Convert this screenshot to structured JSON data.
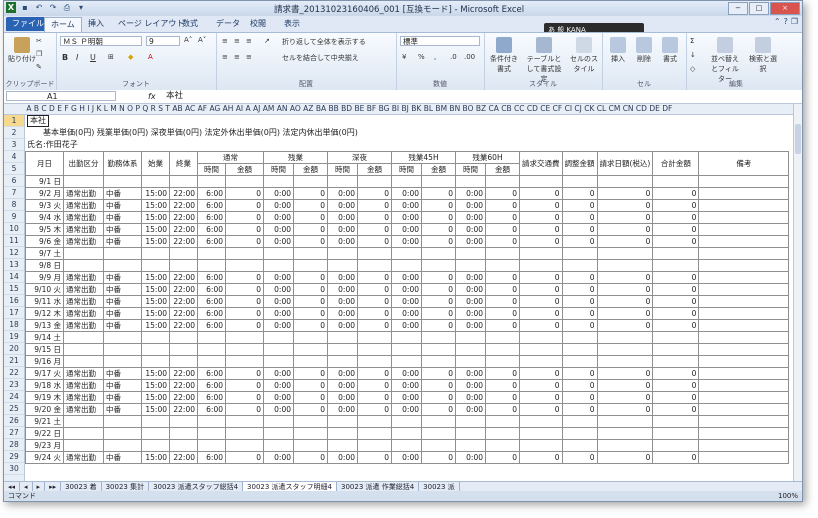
{
  "window": {
    "title": "請求書_20131023160406_001 [互換モード] - Microsoft Excel",
    "qat_icons": [
      "excel-icon",
      "save-icon",
      "undo-icon",
      "redo-icon",
      "print-icon",
      "customize-icon"
    ],
    "controls": [
      "−",
      "□",
      "×"
    ]
  },
  "ime": {
    "label": "あ 般 KANA"
  },
  "tabs": [
    "ファイル",
    "ホーム",
    "挿入",
    "ページ レイアウト",
    "数式",
    "データ",
    "校閲",
    "表示"
  ],
  "ribbon": {
    "clipboard": {
      "label": "クリップボード",
      "paste": "貼り付け"
    },
    "font": {
      "label": "フォント",
      "name": "ＭＳ Ｐ明朝",
      "size": "9",
      "styles": [
        "B",
        "I",
        "U"
      ]
    },
    "alignment": {
      "label": "配置",
      "wrap": "折り返して全体を表示する",
      "merge": "セルを結合して中央揃え"
    },
    "number": {
      "label": "数値",
      "format": "標準"
    },
    "styles": {
      "label": "スタイル",
      "cond": "条件付き書式",
      "table": "テーブルとして書式設定",
      "cell": "セルのスタイル"
    },
    "cells": {
      "label": "セル",
      "insert": "挿入",
      "delete": "削除",
      "format": "書式"
    },
    "editing": {
      "label": "編集",
      "sort": "並べ替えとフィルター",
      "find": "検索と選択"
    }
  },
  "formula_bar": {
    "name_box": "A1",
    "fx": "fx",
    "value": "本社"
  },
  "column_letters": "A B C D E F G H I J K L M N O P Q R S T AB AC AF AG AH AI A AJ AM AN AO AZ BA BB BD BE BF BG BI BJ BK BL BM BN BO BZ CA CB CC CD CE CF CI CJ CK CL CM CN CD DE DF",
  "sheet": {
    "a1": "本社",
    "units": "基本単価(0円)  残業単価(0円)  深夜単価(0円)  法定外休出単価(0円)  法定内休出単価(0円)",
    "name": "氏名:作田花子",
    "headers": {
      "day": "月日",
      "attend": "出勤区分",
      "shift": "勤務体系",
      "start": "始業",
      "end": "終業",
      "normal": "通常",
      "overtime": "残業",
      "night": "深夜",
      "ot45": "残業45H",
      "ot60": "残業60H",
      "expense": "請求交通費",
      "adjust": "調整金額",
      "invoice": "請求日額(税込)",
      "total": "合計金額",
      "note": "備考",
      "time": "時間",
      "amount": "金額"
    },
    "rows": [
      [
        "9/1 日",
        "",
        "",
        "",
        "",
        "",
        "",
        "",
        "",
        "",
        "",
        "",
        "",
        "",
        "",
        "",
        "",
        "",
        "",
        "",
        ""
      ],
      [
        "9/2 月",
        "通常出勤",
        "中番",
        "15:00",
        "22:00",
        "6:00",
        "0",
        "0:00",
        "0",
        "0:00",
        "0",
        "0:00",
        "0",
        "0:00",
        "0",
        "0",
        "0",
        "0",
        "0",
        ""
      ],
      [
        "9/3 火",
        "通常出勤",
        "中番",
        "15:00",
        "22:00",
        "6:00",
        "0",
        "0:00",
        "0",
        "0:00",
        "0",
        "0:00",
        "0",
        "0:00",
        "0",
        "0",
        "0",
        "0",
        "0",
        ""
      ],
      [
        "9/4 水",
        "通常出勤",
        "中番",
        "15:00",
        "22:00",
        "6:00",
        "0",
        "0:00",
        "0",
        "0:00",
        "0",
        "0:00",
        "0",
        "0:00",
        "0",
        "0",
        "0",
        "0",
        "0",
        ""
      ],
      [
        "9/5 木",
        "通常出勤",
        "中番",
        "15:00",
        "22:00",
        "6:00",
        "0",
        "0:00",
        "0",
        "0:00",
        "0",
        "0:00",
        "0",
        "0:00",
        "0",
        "0",
        "0",
        "0",
        "0",
        ""
      ],
      [
        "9/6 金",
        "通常出勤",
        "中番",
        "15:00",
        "22:00",
        "6:00",
        "0",
        "0:00",
        "0",
        "0:00",
        "0",
        "0:00",
        "0",
        "0:00",
        "0",
        "0",
        "0",
        "0",
        "0",
        ""
      ],
      [
        "9/7 土",
        "",
        "",
        "",
        "",
        "",
        "",
        "",
        "",
        "",
        "",
        "",
        "",
        "",
        "",
        "",
        "",
        "",
        "",
        ""
      ],
      [
        "9/8 日",
        "",
        "",
        "",
        "",
        "",
        "",
        "",
        "",
        "",
        "",
        "",
        "",
        "",
        "",
        "",
        "",
        "",
        "",
        ""
      ],
      [
        "9/9 月",
        "通常出勤",
        "中番",
        "15:00",
        "22:00",
        "6:00",
        "0",
        "0:00",
        "0",
        "0:00",
        "0",
        "0:00",
        "0",
        "0:00",
        "0",
        "0",
        "0",
        "0",
        "0",
        ""
      ],
      [
        "9/10 火",
        "通常出勤",
        "中番",
        "15:00",
        "22:00",
        "6:00",
        "0",
        "0:00",
        "0",
        "0:00",
        "0",
        "0:00",
        "0",
        "0:00",
        "0",
        "0",
        "0",
        "0",
        "0",
        ""
      ],
      [
        "9/11 水",
        "通常出勤",
        "中番",
        "15:00",
        "22:00",
        "6:00",
        "0",
        "0:00",
        "0",
        "0:00",
        "0",
        "0:00",
        "0",
        "0:00",
        "0",
        "0",
        "0",
        "0",
        "0",
        ""
      ],
      [
        "9/12 木",
        "通常出勤",
        "中番",
        "15:00",
        "22:00",
        "6:00",
        "0",
        "0:00",
        "0",
        "0:00",
        "0",
        "0:00",
        "0",
        "0:00",
        "0",
        "0",
        "0",
        "0",
        "0",
        ""
      ],
      [
        "9/13 金",
        "通常出勤",
        "中番",
        "15:00",
        "22:00",
        "6:00",
        "0",
        "0:00",
        "0",
        "0:00",
        "0",
        "0:00",
        "0",
        "0:00",
        "0",
        "0",
        "0",
        "0",
        "0",
        ""
      ],
      [
        "9/14 土",
        "",
        "",
        "",
        "",
        "",
        "",
        "",
        "",
        "",
        "",
        "",
        "",
        "",
        "",
        "",
        "",
        "",
        "",
        ""
      ],
      [
        "9/15 日",
        "",
        "",
        "",
        "",
        "",
        "",
        "",
        "",
        "",
        "",
        "",
        "",
        "",
        "",
        "",
        "",
        "",
        "",
        ""
      ],
      [
        "9/16 月",
        "",
        "",
        "",
        "",
        "",
        "",
        "",
        "",
        "",
        "",
        "",
        "",
        "",
        "",
        "",
        "",
        "",
        "",
        ""
      ],
      [
        "9/17 火",
        "通常出勤",
        "中番",
        "15:00",
        "22:00",
        "6:00",
        "0",
        "0:00",
        "0",
        "0:00",
        "0",
        "0:00",
        "0",
        "0:00",
        "0",
        "0",
        "0",
        "0",
        "0",
        ""
      ],
      [
        "9/18 水",
        "通常出勤",
        "中番",
        "15:00",
        "22:00",
        "6:00",
        "0",
        "0:00",
        "0",
        "0:00",
        "0",
        "0:00",
        "0",
        "0:00",
        "0",
        "0",
        "0",
        "0",
        "0",
        ""
      ],
      [
        "9/19 木",
        "通常出勤",
        "中番",
        "15:00",
        "22:00",
        "6:00",
        "0",
        "0:00",
        "0",
        "0:00",
        "0",
        "0:00",
        "0",
        "0:00",
        "0",
        "0",
        "0",
        "0",
        "0",
        ""
      ],
      [
        "9/20 金",
        "通常出勤",
        "中番",
        "15:00",
        "22:00",
        "6:00",
        "0",
        "0:00",
        "0",
        "0:00",
        "0",
        "0:00",
        "0",
        "0:00",
        "0",
        "0",
        "0",
        "0",
        "0",
        ""
      ],
      [
        "9/21 土",
        "",
        "",
        "",
        "",
        "",
        "",
        "",
        "",
        "",
        "",
        "",
        "",
        "",
        "",
        "",
        "",
        "",
        "",
        ""
      ],
      [
        "9/22 日",
        "",
        "",
        "",
        "",
        "",
        "",
        "",
        "",
        "",
        "",
        "",
        "",
        "",
        "",
        "",
        "",
        "",
        "",
        ""
      ],
      [
        "9/23 月",
        "",
        "",
        "",
        "",
        "",
        "",
        "",
        "",
        "",
        "",
        "",
        "",
        "",
        "",
        "",
        "",
        "",
        "",
        ""
      ],
      [
        "9/24 火",
        "通常出勤",
        "中番",
        "15:00",
        "22:00",
        "6:00",
        "0",
        "0:00",
        "0",
        "0:00",
        "0",
        "0:00",
        "0",
        "0:00",
        "0",
        "0",
        "0",
        "0",
        "0",
        ""
      ]
    ]
  },
  "sheet_tabs": [
    "30023 着",
    "30023 集計",
    "30023 派遣スタッフ総括4",
    "30023 派遣スタッフ明細4",
    "30023 派遣 作業総括4",
    "30023 派"
  ],
  "active_sheet": 3,
  "status": {
    "mode": "コマンド",
    "zoom": "100%"
  }
}
